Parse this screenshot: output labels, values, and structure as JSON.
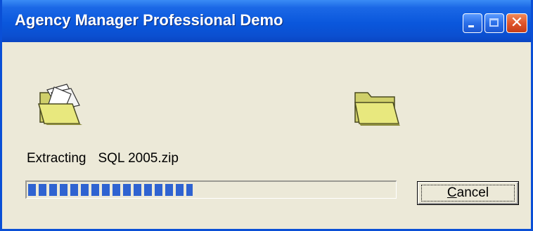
{
  "window": {
    "title": "Agency Manager Professional Demo"
  },
  "titlebar_buttons": {
    "minimize": "minimize-icon",
    "maximize": "maximize-icon",
    "close": "close-icon"
  },
  "icons": {
    "source": "open-folder-icon",
    "destination": "folder-icon"
  },
  "status": {
    "action": "Extracting",
    "file": "SQL 2005.zip"
  },
  "progress": {
    "fraction": 0.45,
    "color": "#2f63d1"
  },
  "cancel_button": {
    "label": "Cancel",
    "accel": "C"
  },
  "colors": {
    "titlebar": "#0a57dc",
    "dialog_bg": "#ece9d8",
    "close_button": "#e0552b"
  }
}
